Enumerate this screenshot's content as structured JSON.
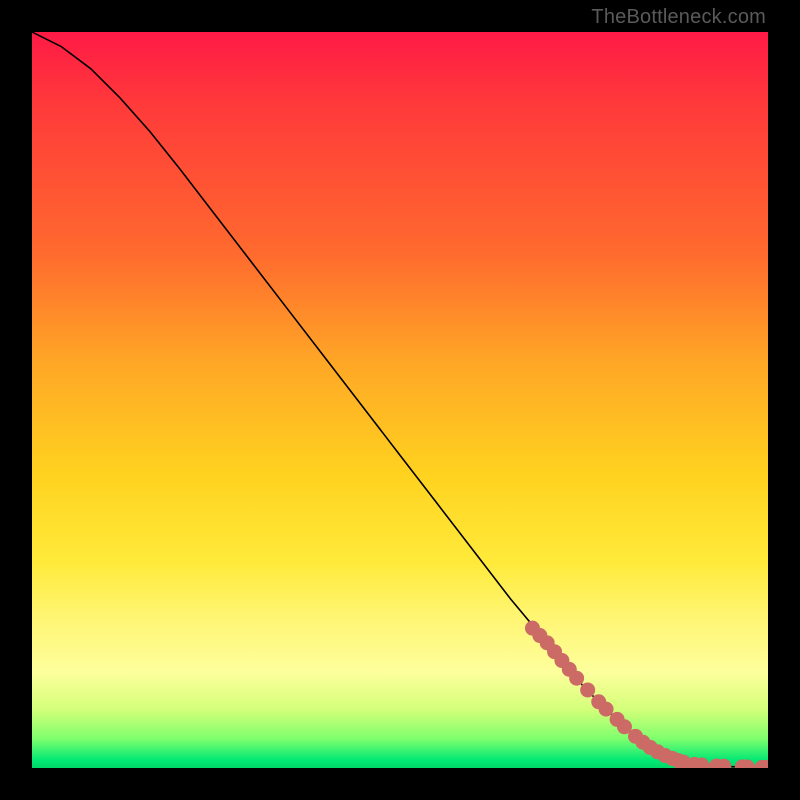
{
  "watermark": "TheBottleneck.com",
  "chart_data": {
    "type": "line",
    "title": "",
    "xlabel": "",
    "ylabel": "",
    "xlim": [
      0,
      100
    ],
    "ylim": [
      0,
      100
    ],
    "series": [
      {
        "name": "curve",
        "x": [
          0,
          4,
          8,
          12,
          16,
          20,
          25,
          30,
          35,
          40,
          45,
          50,
          55,
          60,
          65,
          70,
          75,
          80,
          83,
          86,
          88,
          90,
          92,
          94,
          96,
          98,
          100
        ],
        "y": [
          100,
          98,
          95,
          91,
          86.5,
          81.5,
          75,
          68.5,
          62,
          55.5,
          49,
          42.5,
          36,
          29.5,
          23,
          17,
          11,
          6,
          3.6,
          1.9,
          1.1,
          0.6,
          0.35,
          0.22,
          0.15,
          0.1,
          0.08
        ]
      }
    ],
    "scatter": [
      {
        "name": "dots",
        "color": "#cc6b66",
        "points": [
          {
            "x": 68,
            "y": 19.0
          },
          {
            "x": 69,
            "y": 18.0
          },
          {
            "x": 70,
            "y": 17.0
          },
          {
            "x": 71,
            "y": 15.8
          },
          {
            "x": 72,
            "y": 14.6
          },
          {
            "x": 73,
            "y": 13.4
          },
          {
            "x": 74,
            "y": 12.2
          },
          {
            "x": 75.5,
            "y": 10.6
          },
          {
            "x": 77,
            "y": 9.0
          },
          {
            "x": 78,
            "y": 8.0
          },
          {
            "x": 79.5,
            "y": 6.6
          },
          {
            "x": 80.5,
            "y": 5.6
          },
          {
            "x": 82,
            "y": 4.3
          },
          {
            "x": 83,
            "y": 3.5
          },
          {
            "x": 84,
            "y": 2.8
          },
          {
            "x": 85,
            "y": 2.2
          },
          {
            "x": 86,
            "y": 1.7
          },
          {
            "x": 87,
            "y": 1.3
          },
          {
            "x": 87.8,
            "y": 1.0
          },
          {
            "x": 88.5,
            "y": 0.8
          },
          {
            "x": 90,
            "y": 0.5
          },
          {
            "x": 91,
            "y": 0.4
          },
          {
            "x": 93,
            "y": 0.28
          },
          {
            "x": 94,
            "y": 0.24
          },
          {
            "x": 96.5,
            "y": 0.15
          },
          {
            "x": 97.2,
            "y": 0.13
          },
          {
            "x": 99.2,
            "y": 0.09
          },
          {
            "x": 99.8,
            "y": 0.08
          }
        ]
      }
    ]
  }
}
